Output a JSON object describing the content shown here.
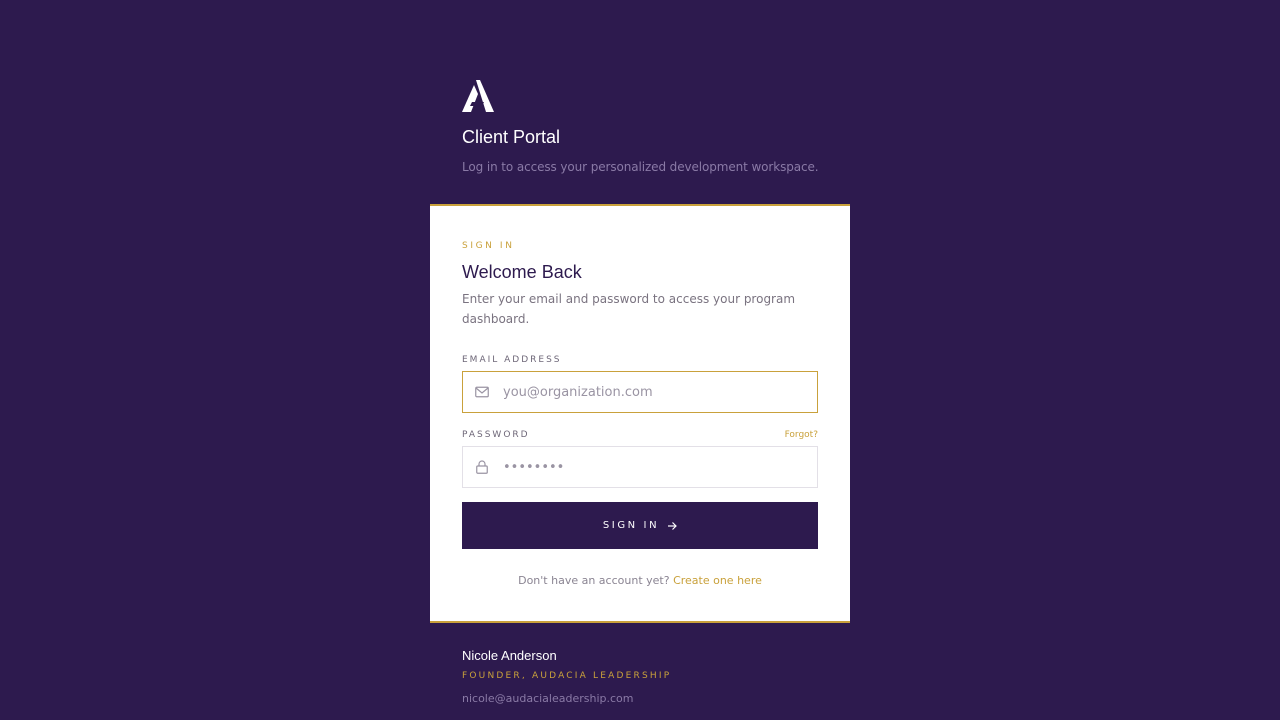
{
  "header": {
    "logo_icon": "audacia-a-logo-icon",
    "title": "Client Portal",
    "subtitle": "Log in to access your personalized development workspace."
  },
  "card": {
    "eyebrow": "SIGN IN",
    "title": "Welcome Back",
    "intro": "Enter your email and password to access your program dashboard.",
    "email": {
      "label": "EMAIL ADDRESS",
      "placeholder": "you@organization.com",
      "value": "",
      "icon": "mail-icon"
    },
    "password": {
      "label": "PASSWORD",
      "forgot_label": "Forgot?",
      "placeholder": "••••••••",
      "value": "",
      "icon": "lock-icon"
    },
    "submit_label": "SIGN IN",
    "submit_icon": "arrow-right-icon",
    "signup_prompt": "Don't have an account yet?",
    "signup_link": "Create one here"
  },
  "footer": {
    "name": "Nicole Anderson",
    "role": "FOUNDER, AUDACIA LEADERSHIP",
    "email": "nicole@audacialeadership.com"
  },
  "colors": {
    "background": "#2d1a4e",
    "accent": "#c9a13b",
    "card": "#ffffff",
    "primary_text": "#2d1a4e"
  }
}
